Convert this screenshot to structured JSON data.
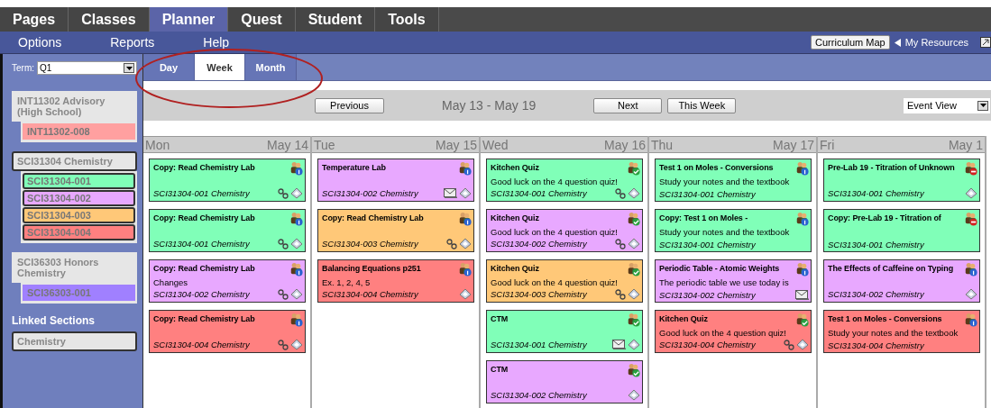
{
  "main_tabs": [
    {
      "label": "Pages",
      "selected": false
    },
    {
      "label": "Classes",
      "selected": false
    },
    {
      "label": "Planner",
      "selected": true
    },
    {
      "label": "Quest",
      "selected": false
    },
    {
      "label": "Student",
      "selected": false
    },
    {
      "label": "Tools",
      "selected": false
    }
  ],
  "sub_menu": [
    "Options",
    "Reports",
    "Help"
  ],
  "curriculum_map_button": "Curriculum Map",
  "my_resources_link": "My Resources",
  "term": {
    "label": "Term:",
    "value": "Q1"
  },
  "class_groups": [
    {
      "title": "INT11302 Advisory (High School)",
      "selected": false,
      "sections": [
        {
          "label": "INT11302-008",
          "color": "#ffa0a0",
          "selected": false
        }
      ]
    },
    {
      "title": "SCI31304 Chemistry",
      "selected": true,
      "sections": [
        {
          "label": "SCI31304-001",
          "color": "#80ffb8",
          "selected": true
        },
        {
          "label": "SCI31304-002",
          "color": "#e8a8ff",
          "selected": true
        },
        {
          "label": "SCI31304-003",
          "color": "#ffc878",
          "selected": true
        },
        {
          "label": "SCI31304-004",
          "color": "#ff8080",
          "selected": true
        }
      ]
    },
    {
      "title": "SCI36303 Honors Chemistry",
      "selected": false,
      "sections": [
        {
          "label": "SCI36303-001",
          "color": "#a080ff",
          "selected": false
        }
      ]
    }
  ],
  "linked_sections": {
    "heading": "Linked Sections",
    "items": [
      {
        "label": "Chemistry",
        "selected": true
      }
    ]
  },
  "view_tabs": [
    {
      "label": "Day",
      "selected": false
    },
    {
      "label": "Week",
      "selected": true
    },
    {
      "label": "Month",
      "selected": false
    }
  ],
  "toolbar": {
    "previous": "Previous",
    "range": "May 13 - May 19",
    "next": "Next",
    "this_week": "This Week",
    "view_select": "Event View"
  },
  "days": [
    {
      "day": "Mon",
      "date": "May 14",
      "events": [
        {
          "title": "Copy: Read Chemistry Lab",
          "section": "SCI31304-001 Chemistry",
          "color": "#80ffb8",
          "kind": "info",
          "link": true,
          "mail": false,
          "book": true
        },
        {
          "title": "Copy: Read Chemistry Lab",
          "section": "SCI31304-001 Chemistry",
          "color": "#80ffb8",
          "kind": "info",
          "link": true,
          "mail": false,
          "book": true
        },
        {
          "title": "Copy: Read Chemistry Lab",
          "note": "Changes",
          "section": "SCI31304-002 Chemistry",
          "color": "#e8a8ff",
          "kind": "info",
          "link": true,
          "mail": false,
          "book": true
        },
        {
          "title": "Copy: Read Chemistry Lab",
          "section": "SCI31304-004 Chemistry",
          "color": "#ff8080",
          "kind": "info",
          "link": true,
          "mail": false,
          "book": true
        }
      ]
    },
    {
      "day": "Tue",
      "date": "May 15",
      "events": [
        {
          "title": "Temperature Lab",
          "section": "SCI31304-002 Chemistry",
          "color": "#e8a8ff",
          "kind": "info",
          "link": false,
          "mail": true,
          "book": true
        },
        {
          "title": "Copy: Read Chemistry Lab",
          "section": "SCI31304-003 Chemistry",
          "color": "#ffc878",
          "kind": "info",
          "link": true,
          "mail": false,
          "book": true
        },
        {
          "title": "Balancing Equations p251",
          "note": "Ex. 1, 2, 4, 5",
          "section": "SCI31304-004 Chemistry",
          "color": "#ff8080",
          "kind": "info",
          "link": false,
          "mail": false,
          "book": true
        }
      ]
    },
    {
      "day": "Wed",
      "date": "May 16",
      "events": [
        {
          "title": "Kitchen Quiz",
          "note": "Good luck on the 4 question quiz!",
          "section": "SCI31304-001 Chemistry",
          "color": "#80ffb8",
          "kind": "check",
          "link": true,
          "mail": false,
          "book": true
        },
        {
          "title": "Kitchen Quiz",
          "note": "Good luck on the 4 question quiz!",
          "section": "SCI31304-002 Chemistry",
          "color": "#e8a8ff",
          "kind": "check",
          "link": true,
          "mail": false,
          "book": true
        },
        {
          "title": "Kitchen Quiz",
          "note": "Good luck on the 4 question quiz!",
          "section": "SCI31304-003 Chemistry",
          "color": "#ffc878",
          "kind": "check",
          "link": true,
          "mail": false,
          "book": true
        },
        {
          "title": "CTM",
          "section": "SCI31304-001 Chemistry",
          "color": "#80ffb8",
          "kind": "check",
          "link": false,
          "mail": true,
          "book": true
        },
        {
          "title": "CTM",
          "section": "SCI31304-002 Chemistry",
          "color": "#e8a8ff",
          "kind": "check",
          "link": false,
          "mail": false,
          "book": true
        }
      ]
    },
    {
      "day": "Thu",
      "date": "May 17",
      "events": [
        {
          "title": "Test 1 on Moles - Conversions",
          "note": "Study your notes and the textbook",
          "section": "SCI31304-001 Chemistry",
          "color": "#80ffb8",
          "kind": "info",
          "link": false,
          "mail": false,
          "book": false
        },
        {
          "title": "Copy: Test 1 on Moles -",
          "note": "Study your notes and the textbook",
          "section": "SCI31304-001 Chemistry",
          "color": "#80ffb8",
          "kind": "info",
          "link": false,
          "mail": false,
          "book": false
        },
        {
          "title": "Periodic Table - Atomic Weights",
          "note": "The periodic table we use today is",
          "section": "SCI31304-002 Chemistry",
          "color": "#e8a8ff",
          "kind": "info",
          "link": false,
          "mail": true,
          "book": false
        },
        {
          "title": "Kitchen Quiz",
          "note": "Good luck on the 4 question quiz!",
          "section": "SCI31304-004 Chemistry",
          "color": "#ff8080",
          "kind": "check",
          "link": true,
          "mail": false,
          "book": true
        }
      ]
    },
    {
      "day": "Fri",
      "date": "May 1",
      "events": [
        {
          "title": "Pre-Lab 19 - Titration of Unknown",
          "section": "SCI31304-001 Chemistry",
          "color": "#80ffb8",
          "kind": "blocked",
          "link": false,
          "mail": false,
          "book": true
        },
        {
          "title": "Copy: Pre-Lab 19 - Titration of",
          "section": "SCI31304-001 Chemistry",
          "color": "#80ffb8",
          "kind": "blocked",
          "link": false,
          "mail": false,
          "book": false
        },
        {
          "title": "The Effects of Caffeine on Typing",
          "section": "SCI31304-002 Chemistry",
          "color": "#e8a8ff",
          "kind": "info",
          "link": false,
          "mail": false,
          "book": true
        },
        {
          "title": "Test 1 on Moles - Conversions",
          "note": "Study your notes and the textbook",
          "section": "SCI31304-004 Chemistry",
          "color": "#ff8080",
          "kind": "info",
          "link": false,
          "mail": false,
          "book": false
        }
      ]
    }
  ]
}
